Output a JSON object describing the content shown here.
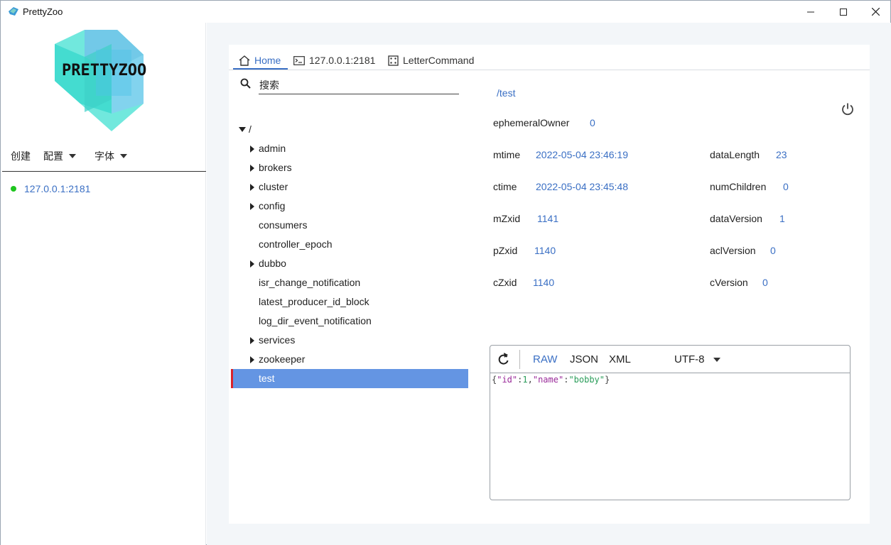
{
  "window": {
    "title": "PrettyZoo",
    "controls": {
      "minimize": "minimize-icon",
      "maximize": "maximize-icon",
      "close": "close-icon"
    }
  },
  "sidebar": {
    "logo_text": "PRETTYZOO",
    "menu": [
      {
        "label": "创建",
        "dropdown": false
      },
      {
        "label": "配置",
        "dropdown": true
      },
      {
        "label": "字体",
        "dropdown": true
      }
    ],
    "servers": [
      {
        "address": "127.0.0.1:2181",
        "status": "connected",
        "status_color": "#1ec51e"
      }
    ]
  },
  "tabs": [
    {
      "label": "Home",
      "icon": "home-icon",
      "active": true
    },
    {
      "label": "127.0.0.1:2181",
      "icon": "terminal-icon",
      "active": false
    },
    {
      "label": "LetterCommand",
      "icon": "dice-icon",
      "active": false
    }
  ],
  "tree": {
    "search_placeholder": "搜索",
    "root": "/",
    "nodes": [
      {
        "label": "admin",
        "has_children": true
      },
      {
        "label": "brokers",
        "has_children": true
      },
      {
        "label": "cluster",
        "has_children": true
      },
      {
        "label": "config",
        "has_children": true
      },
      {
        "label": "consumers",
        "has_children": false
      },
      {
        "label": "controller_epoch",
        "has_children": false
      },
      {
        "label": "dubbo",
        "has_children": true
      },
      {
        "label": "isr_change_notification",
        "has_children": false
      },
      {
        "label": "latest_producer_id_block",
        "has_children": false
      },
      {
        "label": "log_dir_event_notification",
        "has_children": false
      },
      {
        "label": "services",
        "has_children": true
      },
      {
        "label": "zookeeper",
        "has_children": true
      },
      {
        "label": "test",
        "has_children": false,
        "selected": true
      }
    ]
  },
  "node": {
    "path": "/test",
    "stats": {
      "ephemeralOwner": {
        "label": "ephemeralOwner",
        "value": "0"
      },
      "mtime": {
        "label": "mtime",
        "value": "2022-05-04 23:46:19"
      },
      "ctime": {
        "label": "ctime",
        "value": "2022-05-04 23:45:48"
      },
      "mZxid": {
        "label": "mZxid",
        "value": "1141"
      },
      "pZxid": {
        "label": "pZxid",
        "value": "1140"
      },
      "cZxid": {
        "label": "cZxid",
        "value": "1140"
      },
      "dataLength": {
        "label": "dataLength",
        "value": "23"
      },
      "numChildren": {
        "label": "numChildren",
        "value": "0"
      },
      "dataVersion": {
        "label": "dataVersion",
        "value": "1"
      },
      "aclVersion": {
        "label": "aclVersion",
        "value": "0"
      },
      "cVersion": {
        "label": "cVersion",
        "value": "0"
      }
    }
  },
  "editor": {
    "formats": [
      {
        "label": "RAW",
        "active": true
      },
      {
        "label": "JSON",
        "active": false
      },
      {
        "label": "XML",
        "active": false
      }
    ],
    "charset": "UTF-8",
    "content": {
      "open": "{",
      "key1": "\"id\"",
      "colon1": ":",
      "val1": "1",
      "comma": ",",
      "key2": "\"name\"",
      "colon2": ":",
      "val2": "\"bobby\"",
      "close": "}"
    }
  },
  "colors": {
    "accent": "#3a6fc4",
    "selected_row": "#6495e3",
    "selected_marker": "#d9232b"
  }
}
